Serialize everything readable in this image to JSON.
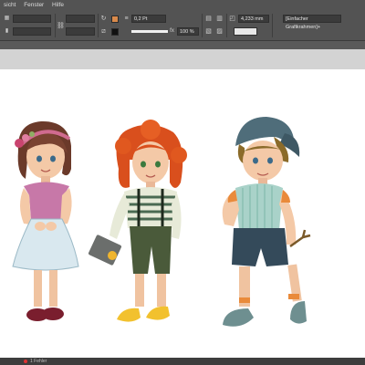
{
  "menu": {
    "items": [
      "sicht",
      "Fenster",
      "Hilfe"
    ]
  },
  "control": {
    "stroke_weight": "0,2 Pt",
    "opacity": "100 %",
    "frame_size": "4,233 mm",
    "object_style": "[Einfacher Grafikrahmen]+"
  },
  "colors": {
    "fill": "#d98a4b",
    "ui_bg": "#535353",
    "page": "#ffffff"
  },
  "status": {
    "text": "1 Fehler"
  }
}
